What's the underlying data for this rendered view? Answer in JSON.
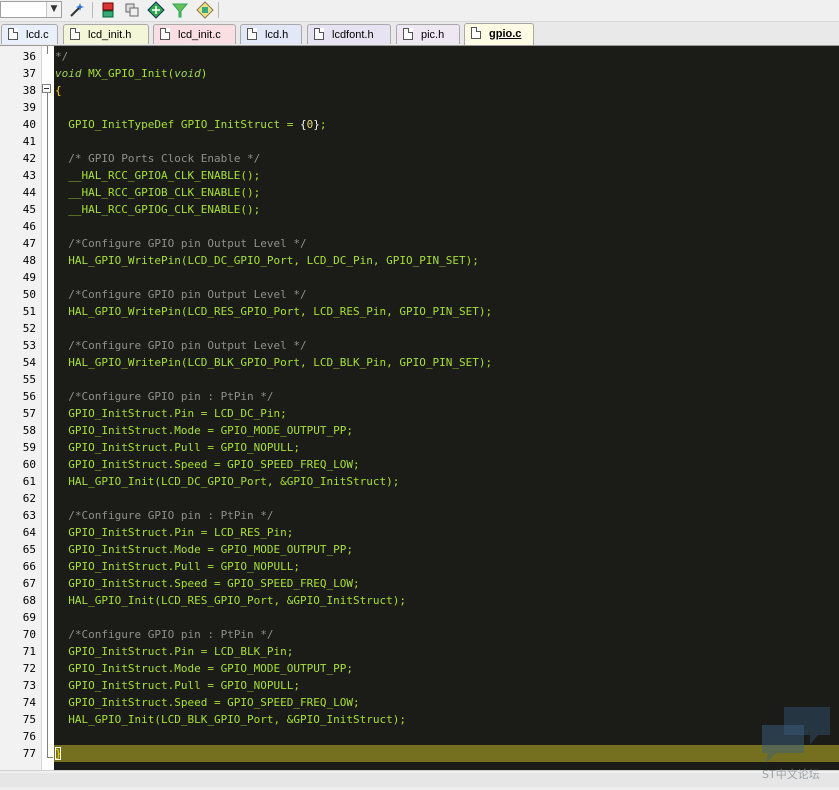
{
  "toolbar": {
    "combo_value": "",
    "buttons": [
      "wizard-icon",
      "insert-icon",
      "overlap-icon",
      "diamond-green-icon",
      "funnel-icon",
      "manage-icon"
    ]
  },
  "tabs": [
    {
      "label": "lcd.c",
      "color": "#eaf0fb"
    },
    {
      "label": "lcd_init.h",
      "color": "#f3f7d7"
    },
    {
      "label": "lcd_init.c",
      "color": "#f9dfe4"
    },
    {
      "label": "lcd.h",
      "color": "#e2e8f7"
    },
    {
      "label": "lcdfont.h",
      "color": "#e8e3f2"
    },
    {
      "label": "pic.h",
      "color": "#efe8f3"
    },
    {
      "label": "gpio.c",
      "color": "#fffbe4",
      "active": true
    }
  ],
  "editor": {
    "lines": [
      {
        "n": "36",
        "text": "*/"
      },
      {
        "n": "37",
        "text": "void MX_GPIO_Init(void)"
      },
      {
        "n": "38",
        "text": "{"
      },
      {
        "n": "39",
        "text": ""
      },
      {
        "n": "40",
        "text": "  GPIO_InitTypeDef GPIO_InitStruct = {0};"
      },
      {
        "n": "41",
        "text": ""
      },
      {
        "n": "42",
        "text": "  /* GPIO Ports Clock Enable */"
      },
      {
        "n": "43",
        "text": "  __HAL_RCC_GPIOA_CLK_ENABLE();"
      },
      {
        "n": "44",
        "text": "  __HAL_RCC_GPIOB_CLK_ENABLE();"
      },
      {
        "n": "45",
        "text": "  __HAL_RCC_GPIOG_CLK_ENABLE();"
      },
      {
        "n": "46",
        "text": ""
      },
      {
        "n": "47",
        "text": "  /*Configure GPIO pin Output Level */"
      },
      {
        "n": "48",
        "text": "  HAL_GPIO_WritePin(LCD_DC_GPIO_Port, LCD_DC_Pin, GPIO_PIN_SET);"
      },
      {
        "n": "49",
        "text": ""
      },
      {
        "n": "50",
        "text": "  /*Configure GPIO pin Output Level */"
      },
      {
        "n": "51",
        "text": "  HAL_GPIO_WritePin(LCD_RES_GPIO_Port, LCD_RES_Pin, GPIO_PIN_SET);"
      },
      {
        "n": "52",
        "text": ""
      },
      {
        "n": "53",
        "text": "  /*Configure GPIO pin Output Level */"
      },
      {
        "n": "54",
        "text": "  HAL_GPIO_WritePin(LCD_BLK_GPIO_Port, LCD_BLK_Pin, GPIO_PIN_SET);"
      },
      {
        "n": "55",
        "text": ""
      },
      {
        "n": "56",
        "text": "  /*Configure GPIO pin : PtPin */"
      },
      {
        "n": "57",
        "text": "  GPIO_InitStruct.Pin = LCD_DC_Pin;"
      },
      {
        "n": "58",
        "text": "  GPIO_InitStruct.Mode = GPIO_MODE_OUTPUT_PP;"
      },
      {
        "n": "59",
        "text": "  GPIO_InitStruct.Pull = GPIO_NOPULL;"
      },
      {
        "n": "60",
        "text": "  GPIO_InitStruct.Speed = GPIO_SPEED_FREQ_LOW;"
      },
      {
        "n": "61",
        "text": "  HAL_GPIO_Init(LCD_DC_GPIO_Port, &GPIO_InitStruct);"
      },
      {
        "n": "62",
        "text": ""
      },
      {
        "n": "63",
        "text": "  /*Configure GPIO pin : PtPin */"
      },
      {
        "n": "64",
        "text": "  GPIO_InitStruct.Pin = LCD_RES_Pin;"
      },
      {
        "n": "65",
        "text": "  GPIO_InitStruct.Mode = GPIO_MODE_OUTPUT_PP;"
      },
      {
        "n": "66",
        "text": "  GPIO_InitStruct.Pull = GPIO_NOPULL;"
      },
      {
        "n": "67",
        "text": "  GPIO_InitStruct.Speed = GPIO_SPEED_FREQ_LOW;"
      },
      {
        "n": "68",
        "text": "  HAL_GPIO_Init(LCD_RES_GPIO_Port, &GPIO_InitStruct);"
      },
      {
        "n": "69",
        "text": ""
      },
      {
        "n": "70",
        "text": "  /*Configure GPIO pin : PtPin */"
      },
      {
        "n": "71",
        "text": "  GPIO_InitStruct.Pin = LCD_BLK_Pin;"
      },
      {
        "n": "72",
        "text": "  GPIO_InitStruct.Mode = GPIO_MODE_OUTPUT_PP;"
      },
      {
        "n": "73",
        "text": "  GPIO_InitStruct.Pull = GPIO_NOPULL;"
      },
      {
        "n": "74",
        "text": "  GPIO_InitStruct.Speed = GPIO_SPEED_FREQ_LOW;"
      },
      {
        "n": "75",
        "text": "  HAL_GPIO_Init(LCD_BLK_GPIO_Port, &GPIO_InitStruct);"
      },
      {
        "n": "76",
        "text": ""
      },
      {
        "n": "77",
        "text": "}",
        "current": true
      }
    ],
    "colors": {
      "background": "#1b1b17",
      "identifier": "#a6e22e",
      "comment": "#8f908a",
      "current_line": "#75701f"
    }
  },
  "watermark": {
    "text": "ST中文论坛",
    "icon": "chat-bubble-icon"
  }
}
